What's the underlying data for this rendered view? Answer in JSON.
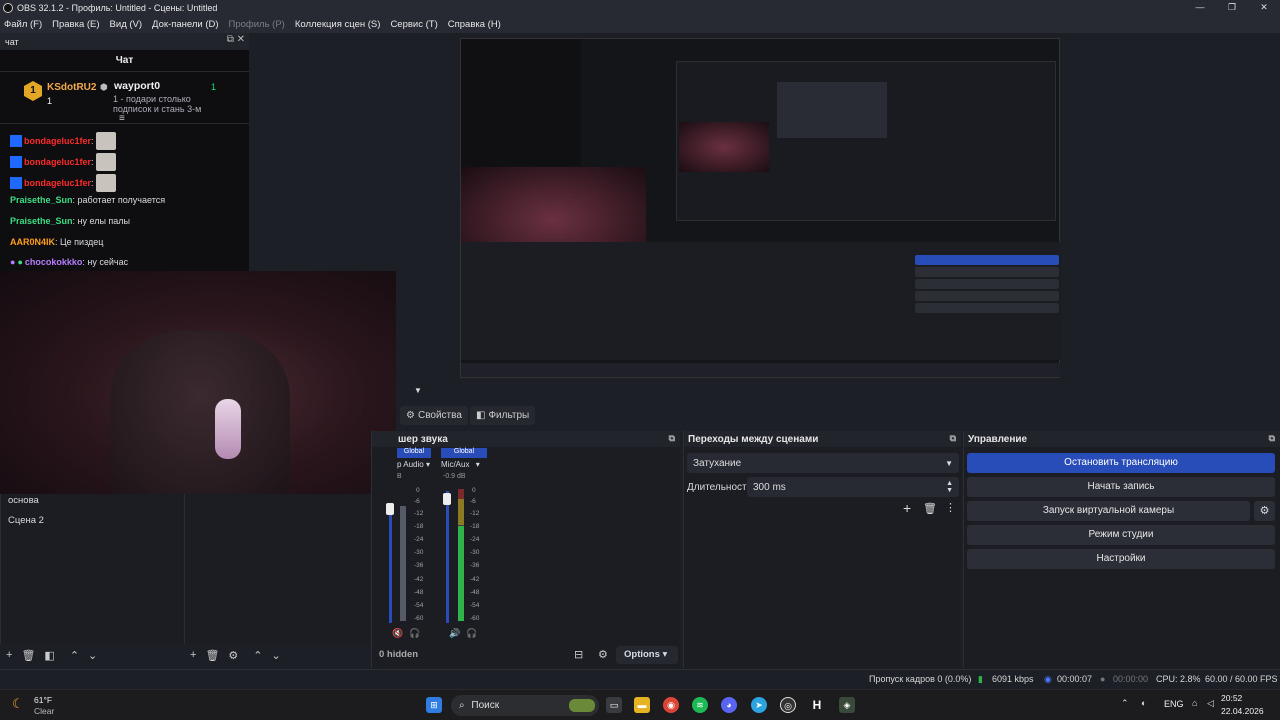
{
  "window": {
    "title": "OBS 32.1.2 - Профиль: Untitled - Сцены: Untitled",
    "controls": [
      "—",
      "❐",
      "✕"
    ]
  },
  "menu": [
    "Файл (F)",
    "Правка (E)",
    "Вид (V)",
    "Док-панели (D)",
    "Профиль (P)",
    "Коллекция сцен (S)",
    "Сервис (T)",
    "Справка (H)"
  ],
  "chat": {
    "dock_title": "чат",
    "title": "Чат",
    "hype": {
      "user1": "KSdotRU2",
      "count1": "1",
      "user2": "wayport0",
      "text2": "1 - подари столько подписок и стань 3-м",
      "count2": "1"
    },
    "messages": [
      {
        "user": "bondageluc1fer",
        "text": ":",
        "color": "#ff2a2a"
      },
      {
        "user": "bondageluc1fer",
        "text": ":",
        "color": "#ff2a2a"
      },
      {
        "user": "bondageluc1fer",
        "text": ":",
        "color": "#ff2a2a"
      },
      {
        "user": "Praisethe_Sun",
        "text": ": работает получается",
        "color": "#3ddc84"
      },
      {
        "user": "Praisethe_Sun",
        "text": ": ну елы палы",
        "color": "#3ddc84"
      },
      {
        "user": "AAR0N4IK",
        "text": ": Це пиздец",
        "color": "#ff9f1a"
      },
      {
        "user": "chocokokkko",
        "text": ": ну сейчас",
        "color": "#b77dff"
      }
    ]
  },
  "props": {
    "properties": "Свойства",
    "filters": "Фильтры"
  },
  "scenes": [
    "основа",
    "Сцена 2"
  ],
  "mixer": {
    "title": "шер звука",
    "ch1": {
      "tag": "Global",
      "name": "p Audio",
      "db": "B"
    },
    "ch2": {
      "tag": "Global",
      "name": "Mic/Aux",
      "db": "-0.9 dB"
    },
    "ticks": [
      "0",
      "-6",
      "-12",
      "-18",
      "-24",
      "-30",
      "-36",
      "-42",
      "-48",
      "-54",
      "-60"
    ],
    "hidden": "0 hidden",
    "options": "Options"
  },
  "transitions": {
    "title": "Переходы между сценами",
    "selected": "Затухание",
    "duration_label": "Длительность",
    "duration": "300 ms"
  },
  "controls": {
    "title": "Управление",
    "stop_stream": "Остановить трансляцию",
    "start_rec": "Начать запись",
    "virtual_cam": "Запуск виртуальной камеры",
    "studio": "Режим студии",
    "settings": "Настройки"
  },
  "status": {
    "dropped": "Пропуск кадров 0 (0.0%)",
    "bitrate": "6091 kbps",
    "stream_time": "00:00:07",
    "rec_time": "00:00:00",
    "cpu": "CPU: 2.8%",
    "fps": "60.00 / 60.00 FPS"
  },
  "taskbar": {
    "temp": "61°F",
    "weather": "Clear",
    "search": "Поиск",
    "lang": "ENG",
    "time": "20:52",
    "date": "22.04.2026"
  },
  "colors": {
    "accent": "#284cb8",
    "meter_green": "#2fb34a",
    "meter_yellow": "#c9b62a",
    "meter_red": "#c23b3b"
  }
}
